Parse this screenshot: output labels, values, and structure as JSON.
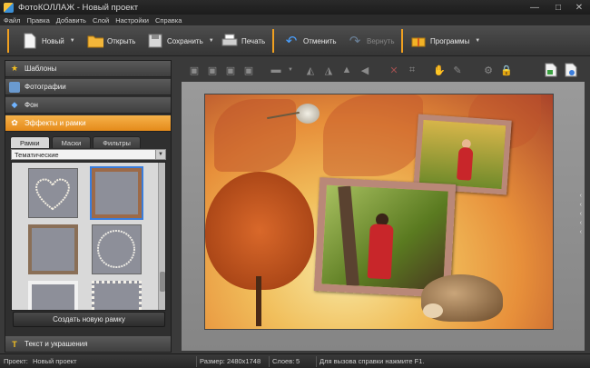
{
  "window": {
    "title": "ФотоКОЛЛАЖ - Новый проект",
    "controls": [
      "—",
      "□",
      "✕"
    ]
  },
  "menu": [
    "Файл",
    "Правка",
    "Добавить",
    "Слой",
    "Настройки",
    "Справка"
  ],
  "toolbar": {
    "new": "Новый",
    "open": "Открыть",
    "save": "Сохранить",
    "print": "Печать",
    "undo": "Отменить",
    "redo": "Вернуть",
    "programs": "Программы"
  },
  "sidebar": {
    "sections": [
      "Шаблоны",
      "Фотографии",
      "Фон",
      "Эффекты и рамки"
    ],
    "bottom_section": "Текст и украшения",
    "tabs": [
      "Рамки",
      "Маски",
      "Фильтры"
    ],
    "category": "Тематические",
    "create_button": "Создать новую рамку"
  },
  "status": {
    "project_label": "Проект:",
    "project_value": "Новый проект",
    "size_label": "Размер:",
    "size_value": "2480x1748",
    "layers_label": "Слоев:",
    "layers_value": "5",
    "help": "Для вызова справки нажмите F1."
  },
  "colors": {
    "accent": "#f0a020",
    "selection": "#3a7ddc"
  }
}
